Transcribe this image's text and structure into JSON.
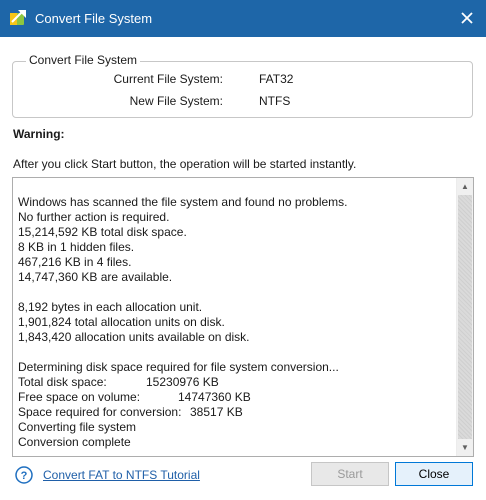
{
  "window": {
    "title": "Convert File System",
    "icons": {
      "app": "partition-tool-icon",
      "close": "close-icon",
      "help": "help-icon"
    },
    "colors": {
      "titlebar": "#1e66a8",
      "link": "#1f5fa8"
    }
  },
  "groupbox": {
    "title": "Convert File System",
    "current_label": "Current File System:",
    "current_value": "FAT32",
    "new_label": "New File System:",
    "new_value": "NTFS"
  },
  "warning": {
    "title": "Warning:",
    "text": "After you click Start button, the operation will be started instantly."
  },
  "log": {
    "lines": [
      "Windows has scanned the file system and found no problems.",
      "No further action is required.",
      "15,214,592 KB total disk space.",
      "8 KB in 1 hidden files.",
      "467,216 KB in 4 files.",
      "14,747,360 KB are available.",
      "",
      "8,192 bytes in each allocation unit.",
      "1,901,824 total allocation units on disk.",
      "1,843,420 allocation units available on disk.",
      "",
      "Determining disk space required for file system conversion..."
    ],
    "pairs": [
      {
        "label": "Total disk space:",
        "value": "15230976 KB"
      },
      {
        "label": "Free space on volume:",
        "value": "14747360 KB"
      },
      {
        "label": "Space required for conversion:",
        "value": "38517 KB"
      }
    ],
    "tail": [
      "Converting file system",
      "Conversion complete"
    ]
  },
  "footer": {
    "help_link": "Convert FAT to NTFS Tutorial",
    "start_label": "Start",
    "close_label": "Close"
  }
}
